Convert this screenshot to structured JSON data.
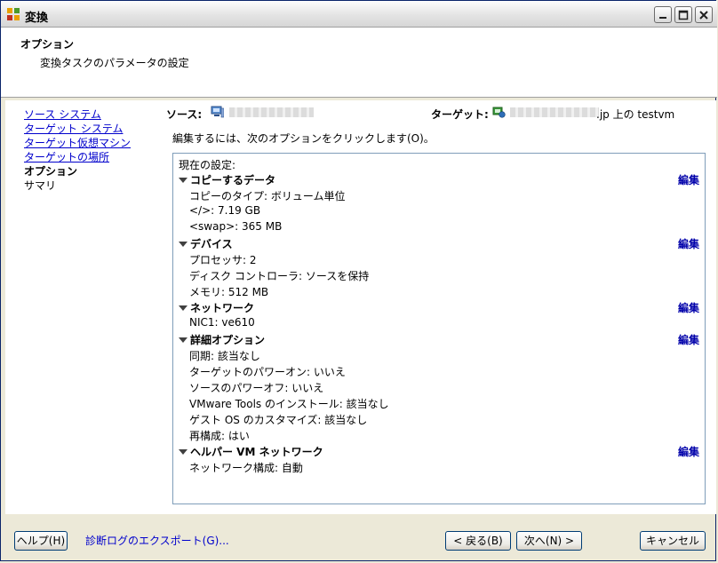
{
  "window": {
    "title": "変換"
  },
  "header": {
    "title": "オプション",
    "subtitle": "変換タスクのパラメータの設定"
  },
  "nav": {
    "items": [
      {
        "label": "ソース システム",
        "state": "link"
      },
      {
        "label": "ターゲット システム",
        "state": "link"
      },
      {
        "label": "ターゲット仮想マシン",
        "state": "link"
      },
      {
        "label": "ターゲットの場所",
        "state": "link"
      },
      {
        "label": "オプション",
        "state": "current"
      },
      {
        "label": "サマリ",
        "state": "plain"
      }
    ]
  },
  "summary": {
    "source_label": "ソース:",
    "target_label": "ターゲット:",
    "target_value": ".jp 上の testvm"
  },
  "instruction": "編集するには、次のオプションをクリックします(O)。",
  "options": {
    "current_settings_label": "現在の設定:",
    "edit_label": "編集",
    "sections": [
      {
        "title": "コピーするデータ",
        "items": [
          "コピーのタイプ: ボリューム単位",
          "</>: 7.19 GB",
          "<swap>: 365 MB"
        ]
      },
      {
        "title": "デバイス",
        "items": [
          "プロセッサ: 2",
          "ディスク コントローラ: ソースを保持",
          "メモリ: 512 MB"
        ]
      },
      {
        "title": "ネットワーク",
        "items": [
          "NIC1: ve610"
        ]
      },
      {
        "title": "詳細オプション",
        "items": [
          "同期: 該当なし",
          "ターゲットのパワーオン: いいえ",
          "ソースのパワーオフ: いいえ",
          "VMware Tools のインストール: 該当なし",
          "ゲスト OS のカスタマイズ: 該当なし",
          "再構成: はい"
        ]
      },
      {
        "title": "ヘルパー VM ネットワーク",
        "items": [
          "ネットワーク構成: 自動"
        ]
      }
    ]
  },
  "footer": {
    "help": "ヘルプ(H)",
    "export_log": "診断ログのエクスポート(G)...",
    "back": "< 戻る(B)",
    "next": "次へ(N) >",
    "cancel": "キャンセル"
  },
  "colors": {
    "link": "#0000cc",
    "edit": "#0000aa",
    "box_border": "#7f9db9"
  }
}
